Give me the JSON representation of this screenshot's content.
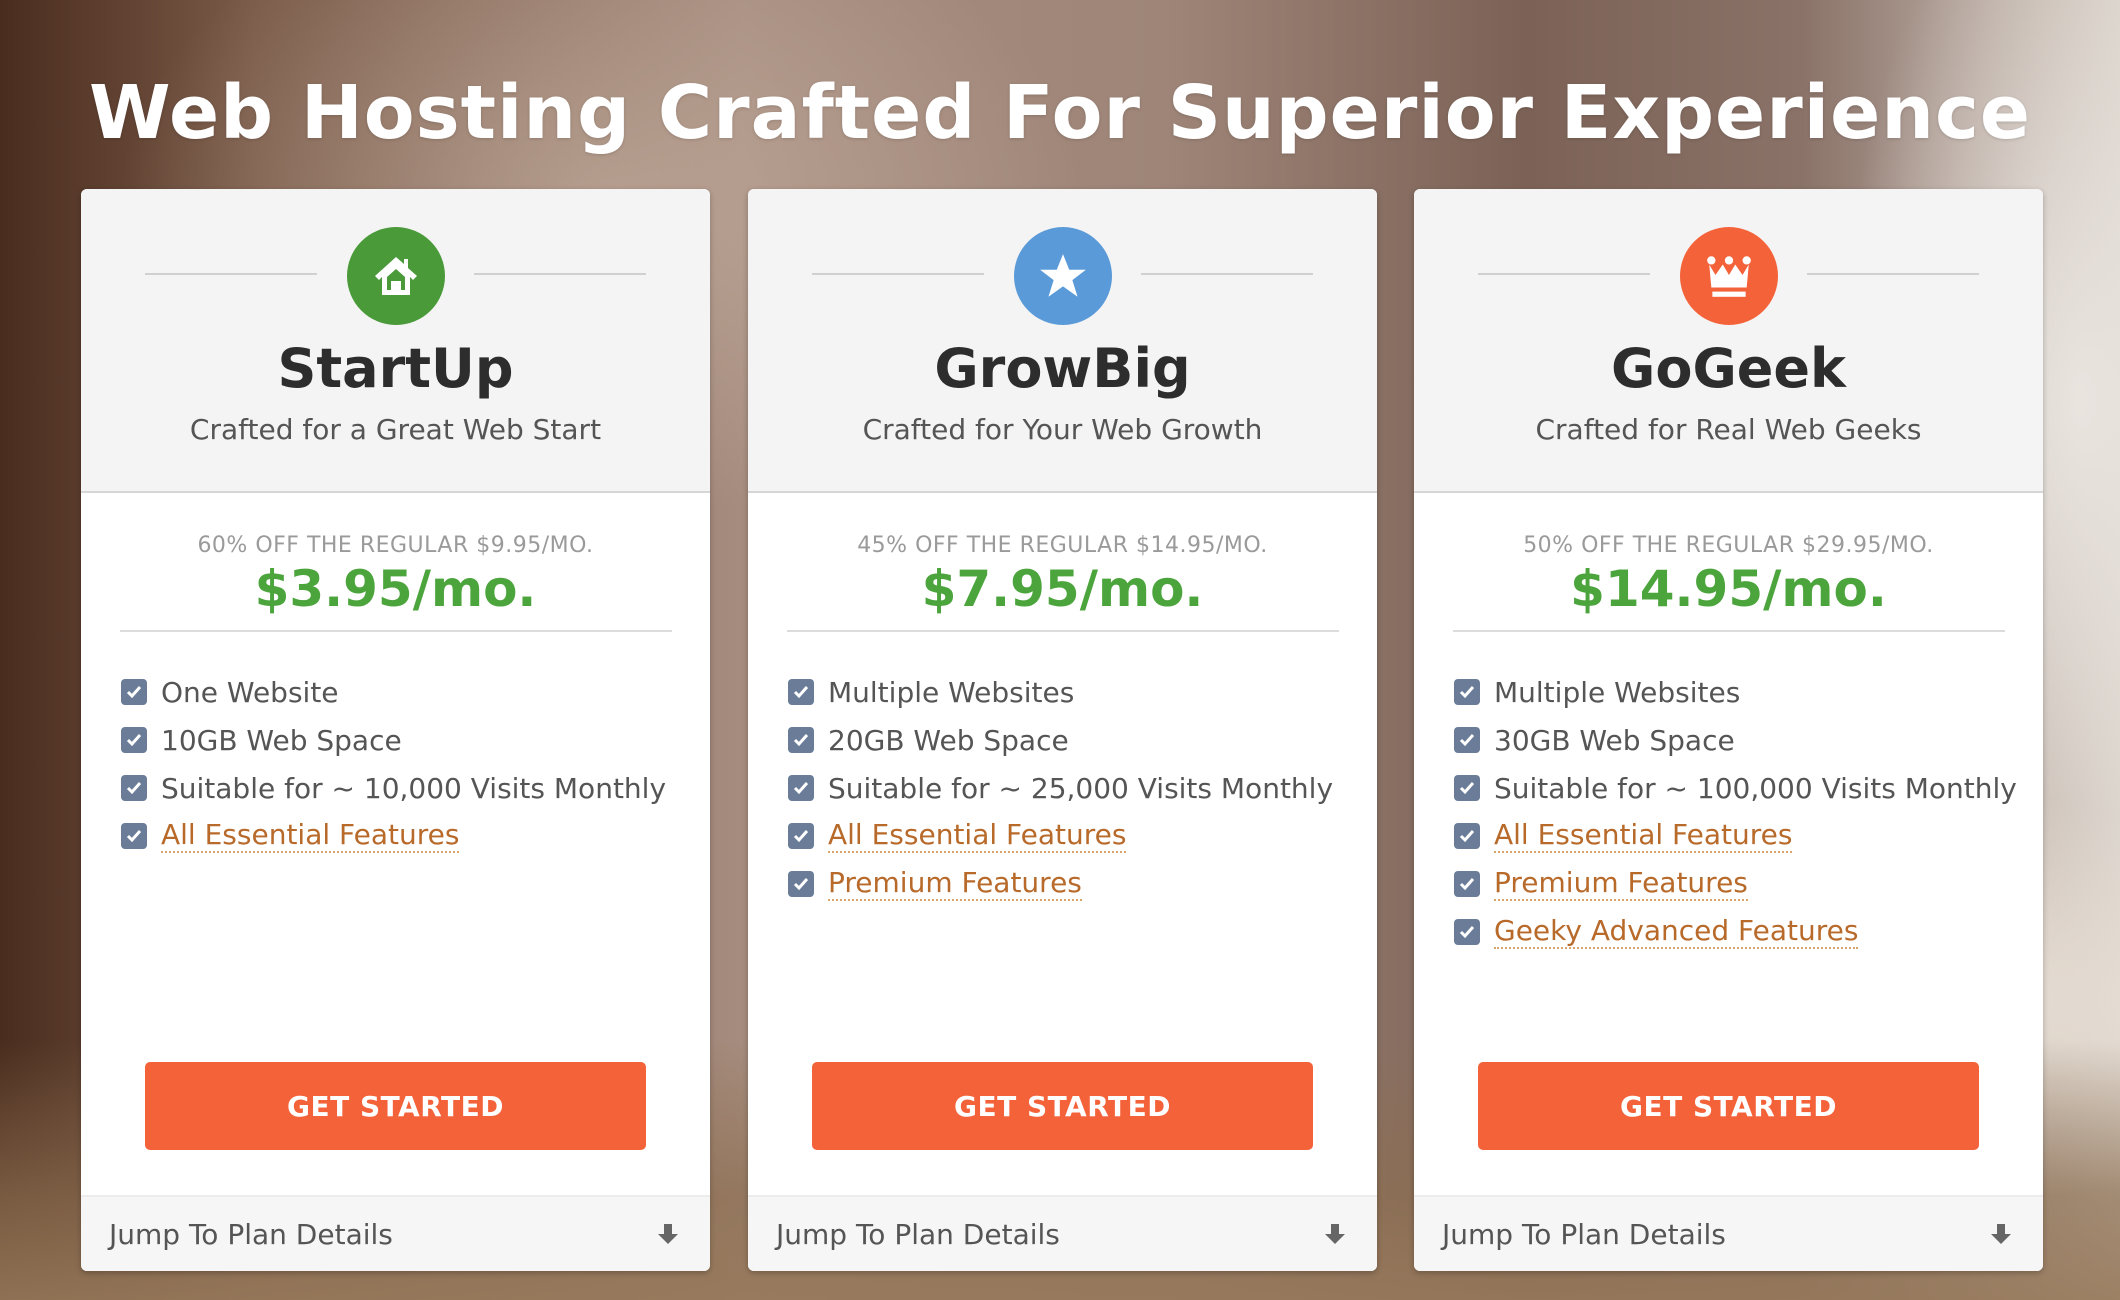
{
  "page": {
    "title": "Web Hosting Crafted For Superior Experience"
  },
  "colors": {
    "price_green": "#4ca43c",
    "cta_orange": "#f4623a",
    "check_blue_gray": "#6a7c98",
    "link_orange": "#b86a2a"
  },
  "plans": [
    {
      "name": "StartUp",
      "tagline": "Crafted for a Great Web Start",
      "icon": "home-icon",
      "icon_color": "#4a9a3a",
      "discount": "60% OFF THE REGULAR $9.95/MO.",
      "price": "$3.95/mo.",
      "features": [
        {
          "label": "One Website",
          "link": false
        },
        {
          "label": "10GB Web Space",
          "link": false
        },
        {
          "label": "Suitable for ~ 10,000 Visits Monthly",
          "link": false
        },
        {
          "label": "All Essential Features",
          "link": true
        }
      ],
      "cta": "GET STARTED",
      "footer": "Jump To Plan Details"
    },
    {
      "name": "GrowBig",
      "tagline": "Crafted for Your Web Growth",
      "icon": "star-icon",
      "icon_color": "#5a9ad8",
      "discount": "45% OFF THE REGULAR $14.95/MO.",
      "price": "$7.95/mo.",
      "features": [
        {
          "label": "Multiple Websites",
          "link": false
        },
        {
          "label": "20GB Web Space",
          "link": false
        },
        {
          "label": "Suitable for ~ 25,000 Visits Monthly",
          "link": false
        },
        {
          "label": "All Essential Features",
          "link": true
        },
        {
          "label": "Premium Features",
          "link": true
        }
      ],
      "cta": "GET STARTED",
      "footer": "Jump To Plan Details"
    },
    {
      "name": "GoGeek",
      "tagline": "Crafted for Real Web Geeks",
      "icon": "crown-icon",
      "icon_color": "#f4623a",
      "discount": "50% OFF THE REGULAR $29.95/MO.",
      "price": "$14.95/mo.",
      "features": [
        {
          "label": "Multiple Websites",
          "link": false
        },
        {
          "label": "30GB Web Space",
          "link": false
        },
        {
          "label": "Suitable for ~ 100,000 Visits Monthly",
          "link": false
        },
        {
          "label": "All Essential Features",
          "link": true
        },
        {
          "label": "Premium Features",
          "link": true
        },
        {
          "label": "Geeky Advanced Features",
          "link": true
        }
      ],
      "cta": "GET STARTED",
      "footer": "Jump To Plan Details"
    }
  ]
}
